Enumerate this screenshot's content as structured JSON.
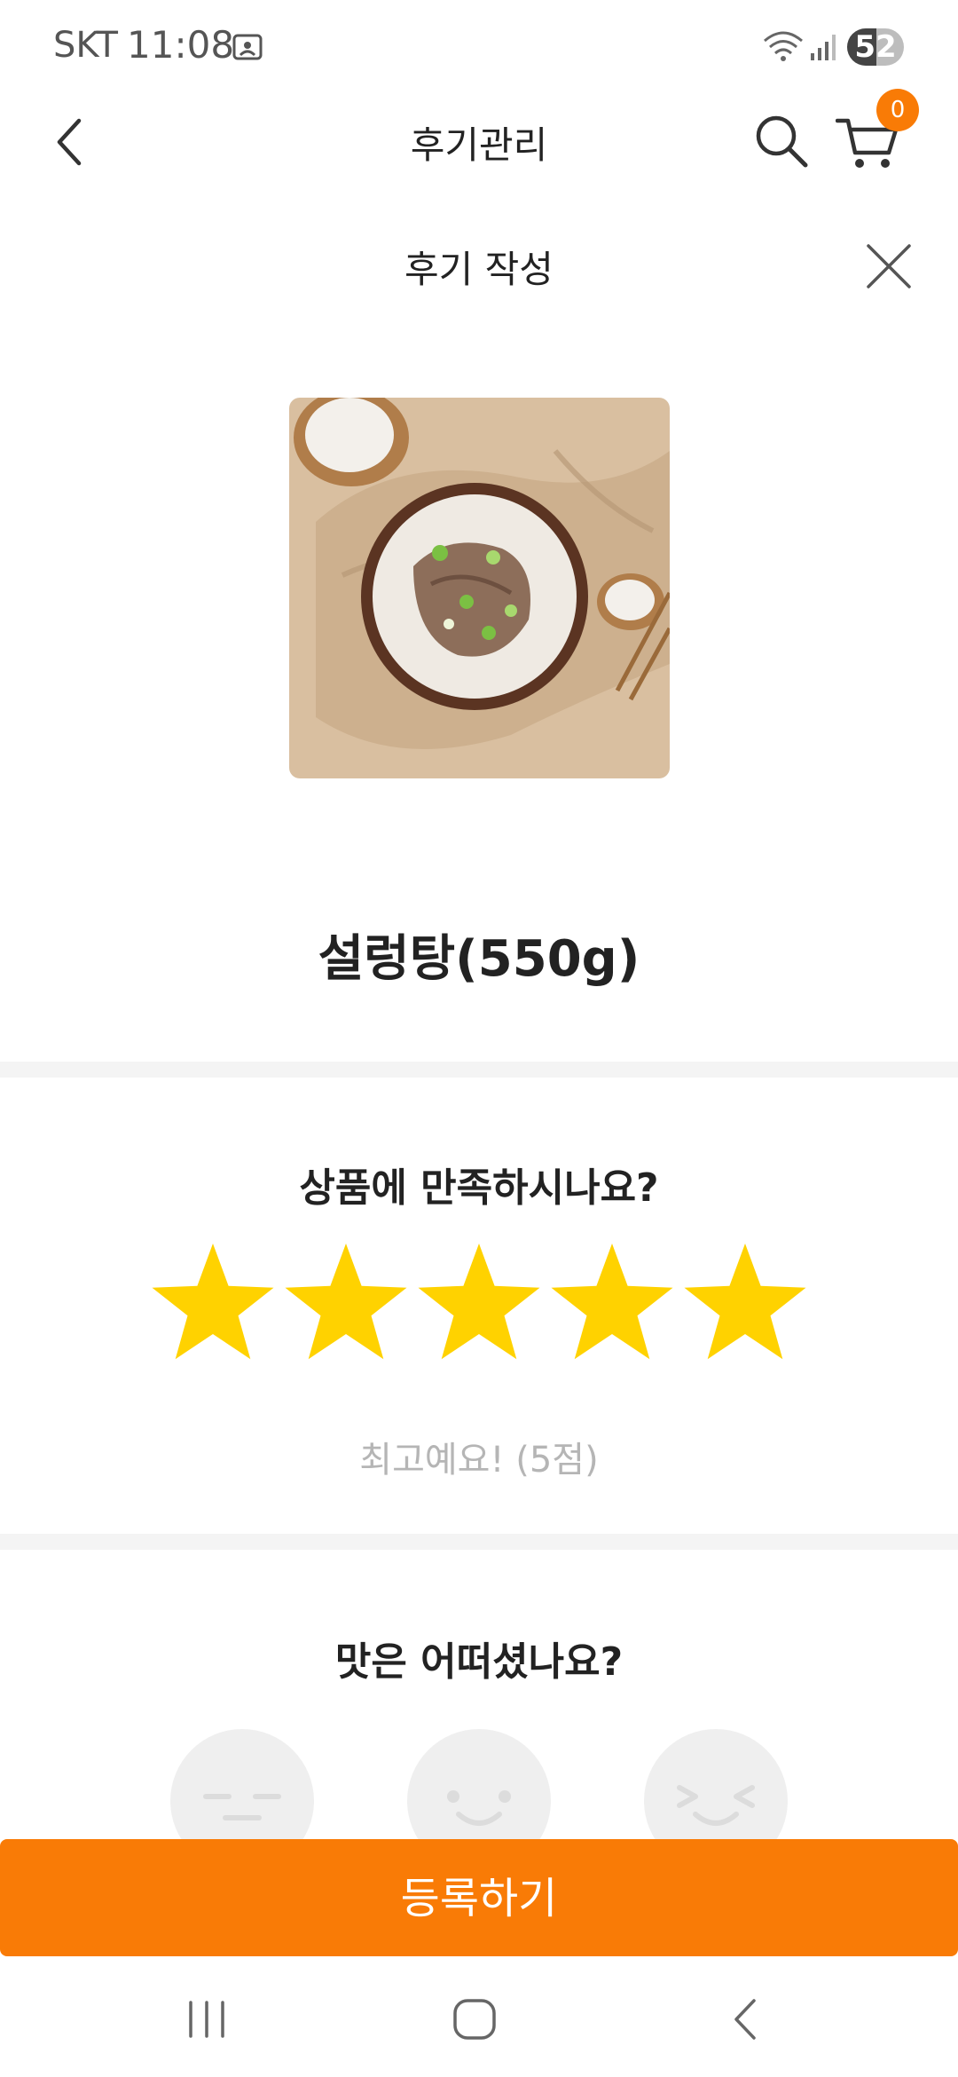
{
  "status_bar": {
    "carrier": "SKT",
    "time": "11:08",
    "battery": "52",
    "battery_level": 0.52
  },
  "header": {
    "title": "후기관리",
    "cart_count": "0"
  },
  "review": {
    "title": "후기 작성",
    "product_name": "설렁탕(550g)",
    "satisfaction_question": "상품에 만족하시나요?",
    "rating": 5,
    "rating_max": 5,
    "rating_text": "최고예요! (5점)",
    "taste_question": "맛은 어떠셨나요?"
  },
  "submit_label": "등록하기",
  "colors": {
    "accent": "#f97b06",
    "star": "#ffd200",
    "face": "#efefef"
  },
  "icons": [
    "back-icon",
    "search-icon",
    "cart-icon",
    "close-icon",
    "star-icon",
    "neutral-face-icon",
    "smile-face-icon",
    "laugh-face-icon",
    "recents-icon",
    "home-icon",
    "nav-back-icon"
  ]
}
